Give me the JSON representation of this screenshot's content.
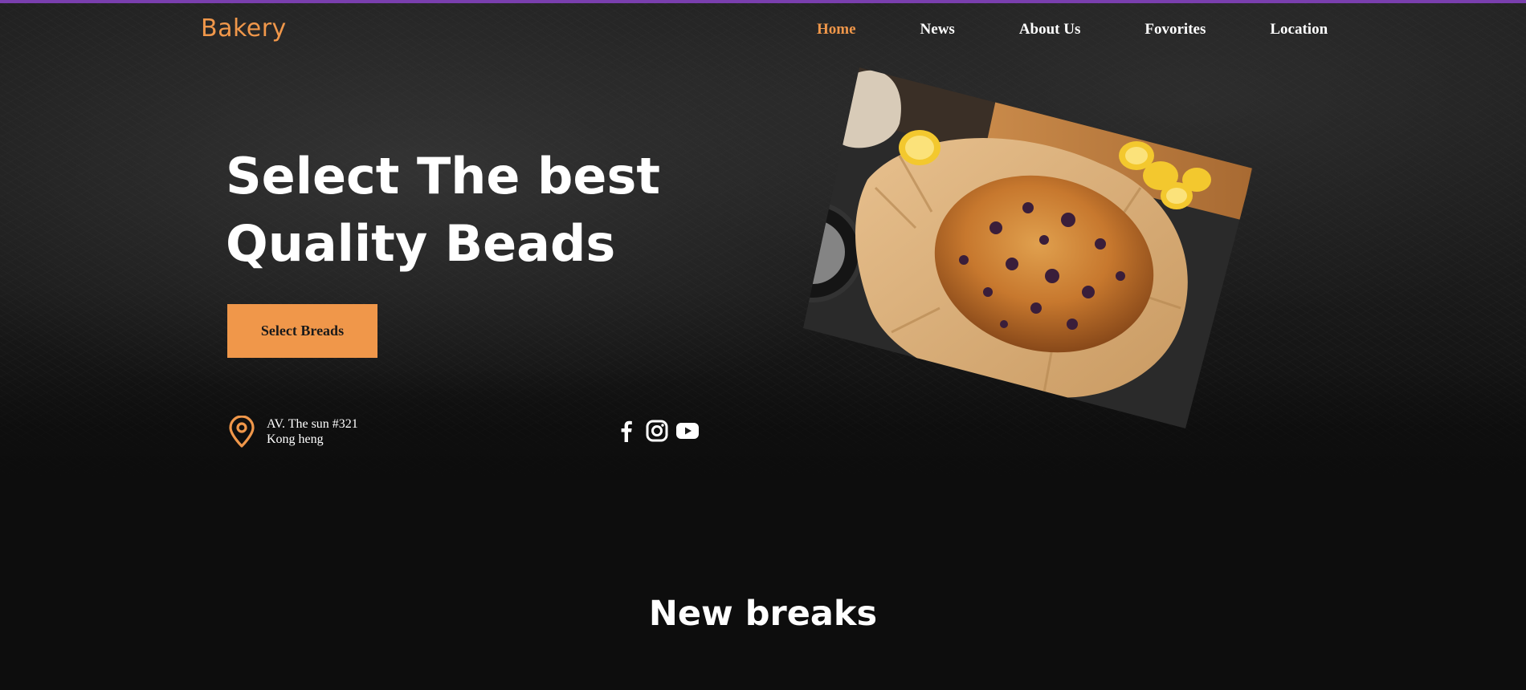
{
  "colors": {
    "accent": "#f0974a",
    "top_bar": "#7a3fae",
    "background": "#0d0d0d",
    "text": "#ffffff"
  },
  "brand": {
    "logo": "Bakery"
  },
  "nav": {
    "items": [
      {
        "label": "Home",
        "active": true
      },
      {
        "label": "News",
        "active": false
      },
      {
        "label": "About Us",
        "active": false
      },
      {
        "label": "Fovorites",
        "active": false
      },
      {
        "label": "Location",
        "active": false
      }
    ]
  },
  "hero": {
    "headline_line1": "Select The best",
    "headline_line2": "Quality Beads",
    "cta_label": "Select Breads",
    "address_line1": "AV. The sun #321",
    "address_line2": "Kong heng",
    "image_icon": "blueberry-cake-photo"
  },
  "social": {
    "icons": [
      "facebook-icon",
      "instagram-icon",
      "youtube-icon"
    ]
  },
  "sections": {
    "new_title": "New breaks"
  }
}
